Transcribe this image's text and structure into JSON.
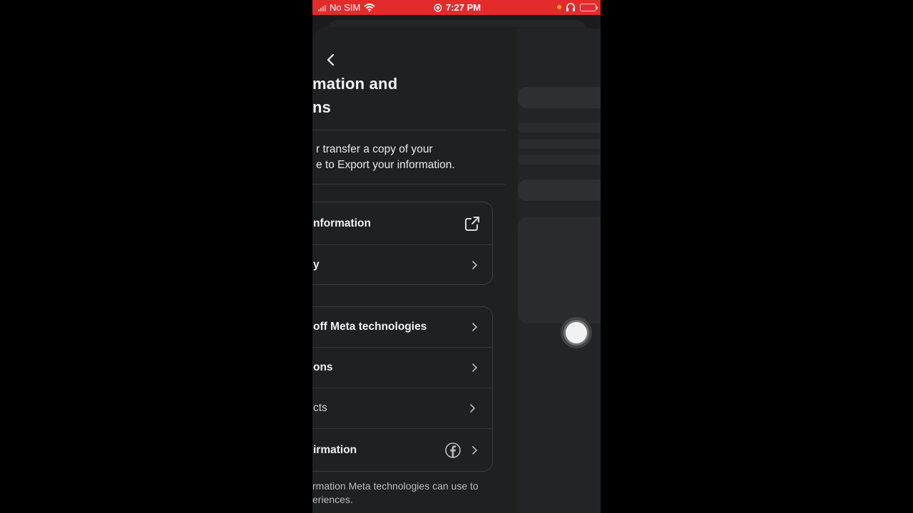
{
  "status_bar": {
    "carrier": "No SIM",
    "time": "7:27 PM"
  },
  "page": {
    "title_line1": "mation and",
    "title_line2": "ns",
    "description_line1": "r transfer a copy of your",
    "description_line2": "e to Export your information."
  },
  "group1": {
    "items": [
      {
        "label": "nformation",
        "icon": "external-link-icon"
      },
      {
        "label": "y",
        "icon": "chevron-right-icon"
      }
    ]
  },
  "group2": {
    "items": [
      {
        "label": "off Meta technologies",
        "icon": "chevron-right-icon"
      },
      {
        "label": "ons",
        "icon": "chevron-right-icon"
      },
      {
        "label": "cts",
        "icon": "chevron-right-icon"
      },
      {
        "label": "irmation",
        "icon": "facebook-icon"
      }
    ]
  },
  "footer": {
    "line1": "rmation Meta technologies can use to",
    "line2": "eriences."
  },
  "colors": {
    "status_bar": "#e32b2b",
    "background": "#1f2022",
    "text": "#f2f2f2"
  }
}
